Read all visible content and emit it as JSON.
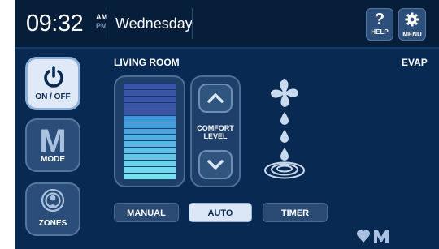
{
  "header": {
    "time": "09:32",
    "am_label": "AM",
    "pm_label": "PM",
    "day": "Wednesday",
    "help_label": "HELP",
    "help_glyph": "?",
    "menu_label": "MENU"
  },
  "zone": {
    "title": "LIVING ROOM",
    "mode_name": "EVAP"
  },
  "sidebar": {
    "onoff_label": "ON / OFF",
    "mode_label": "MODE",
    "mode_glyph": "M",
    "zones_label": "ZONES"
  },
  "comfort": {
    "label_line1": "COMFORT",
    "label_line2": "LEVEL",
    "level": 10,
    "max_level": 15
  },
  "bottom_buttons": {
    "manual": "MANUAL",
    "auto": "AUTO",
    "timer": "TIMER",
    "selected": "AUTO"
  },
  "icons": {
    "power": "power-icon",
    "zones": "zones-icon",
    "help": "help-icon",
    "menu": "gear-icon",
    "fan": "fan-icon",
    "water": "water-drop-icon",
    "brand": "brand-logo-icon"
  },
  "colors": {
    "background": "#082a52",
    "bar_active": "#4a9ad8",
    "bar_inactive": "#3a54a8",
    "accent_light": "#dbe7f6"
  }
}
